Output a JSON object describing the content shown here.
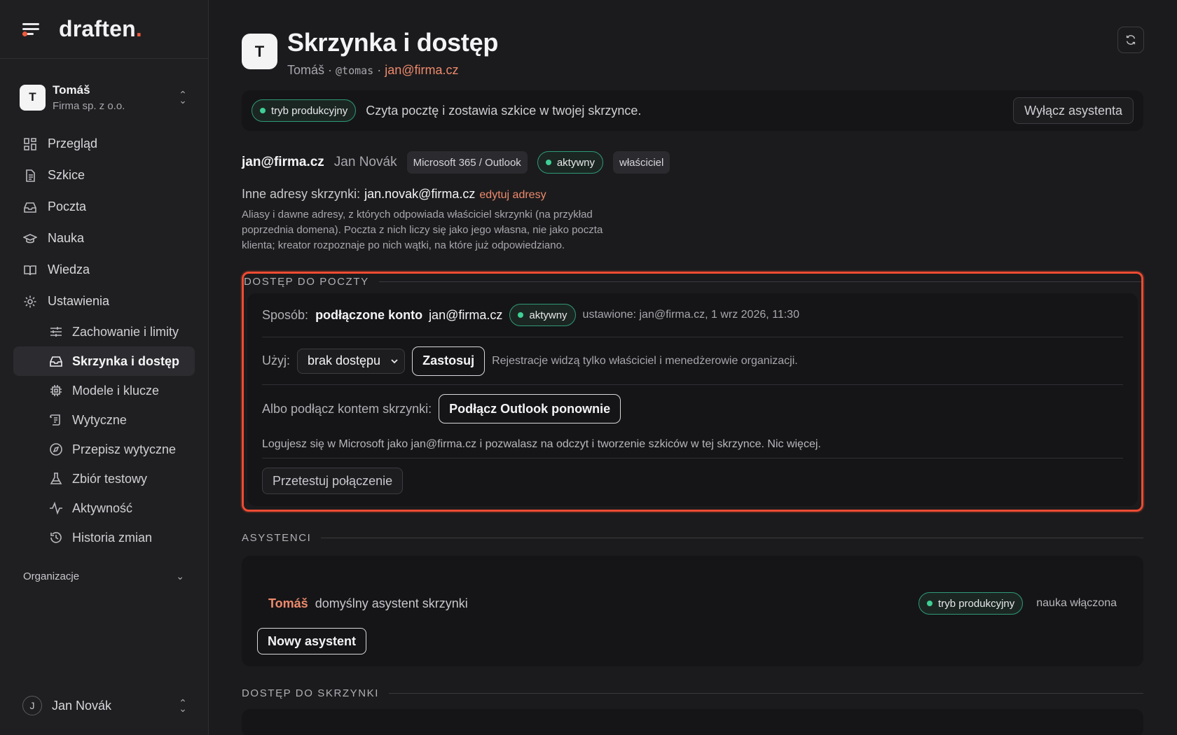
{
  "brand": {
    "name": "draften",
    "dot": "."
  },
  "account": {
    "initial": "T",
    "name": "Tomáš",
    "org": "Firma sp. z o.o."
  },
  "nav": [
    {
      "label": "Przegląd",
      "icon": "grid-icon"
    },
    {
      "label": "Szkice",
      "icon": "document-icon"
    },
    {
      "label": "Poczta",
      "icon": "inbox-icon"
    },
    {
      "label": "Nauka",
      "icon": "graduation-cap-icon"
    },
    {
      "label": "Wiedza",
      "icon": "book-icon"
    },
    {
      "label": "Ustawienia",
      "icon": "gear-icon"
    }
  ],
  "settings_sub": [
    {
      "label": "Zachowanie i limity",
      "icon": "sliders-icon"
    },
    {
      "label": "Skrzynka i dostęp",
      "icon": "inbox-icon",
      "active": true
    },
    {
      "label": "Modele i klucze",
      "icon": "chip-icon"
    },
    {
      "label": "Wytyczne",
      "icon": "scroll-icon"
    },
    {
      "label": "Przepisz wytyczne",
      "icon": "compass-icon"
    },
    {
      "label": "Zbiór testowy",
      "icon": "flask-icon"
    },
    {
      "label": "Aktywność",
      "icon": "activity-icon"
    },
    {
      "label": "Historia zmian",
      "icon": "history-icon"
    }
  ],
  "org_section": "Organizacje",
  "footer_user": {
    "initial": "J",
    "name": "Jan Novák"
  },
  "header": {
    "initial": "T",
    "title": "Skrzynka i dostęp",
    "name": "Tomáš",
    "sep1": " · ",
    "handle": "@tomas",
    "sep2": " · ",
    "email": "jan@firma.cz"
  },
  "mode_bar": {
    "pill": "tryb produkcyjny",
    "text": "Czyta pocztę i zostawia szkice w twojej skrzynce.",
    "button": "Wyłącz asystenta"
  },
  "mailbox": {
    "email": "jan@firma.cz",
    "name": "Jan Novák",
    "provider": "Microsoft 365 / Outlook",
    "status": "aktywny",
    "role": "właściciel"
  },
  "aliases": {
    "label": "Inne adresy skrzynki:",
    "value": "jan.novak@firma.cz",
    "edit": "edytuj adresy",
    "description": "Aliasy i dawne adresy, z których odpowiada właściciel skrzynki (na przykład poprzednia domena). Poczta z nich liczy się jako jego własna, nie jako poczta klienta; kreator rozpoznaje po nich wątki, na które już odpowiedziano."
  },
  "access": {
    "section": "DOSTĘP DO POCZTY",
    "method_label": "Sposób:",
    "method_value": "podłączone konto",
    "method_email": "jan@firma.cz",
    "method_status": "aktywny",
    "method_meta": "ustawione: jan@firma.cz, 1 wrz 2026, 11:30",
    "use_label": "Użyj:",
    "use_select": "brak dostępu",
    "apply": "Zastosuj",
    "use_note": "Rejestracje widzą tylko właściciel i menedżerowie organizacji.",
    "connect_label": "Albo podłącz kontem skrzynki:",
    "connect_button": "Podłącz Outlook ponownie",
    "connect_desc": "Logujesz się w Microsoft jako jan@firma.cz i pozwalasz na odczyt i tworzenie szkiców w tej skrzynce. Nic więcej.",
    "test_button": "Przetestuj połączenie"
  },
  "assistants": {
    "section": "ASYSTENCI",
    "name": "Tomáš",
    "desc": "domyślny asystent skrzynki",
    "mode": "tryb produkcyjny",
    "learning": "nauka włączona",
    "new_button": "Nowy asystent"
  },
  "mailbox_access": {
    "section": "DOSTĘP DO SKRZYNKI"
  },
  "colors": {
    "accent": "#ee5a3c",
    "link": "#ee8a6c",
    "success": "#3fcf95",
    "highlight": "#ee4b32"
  }
}
